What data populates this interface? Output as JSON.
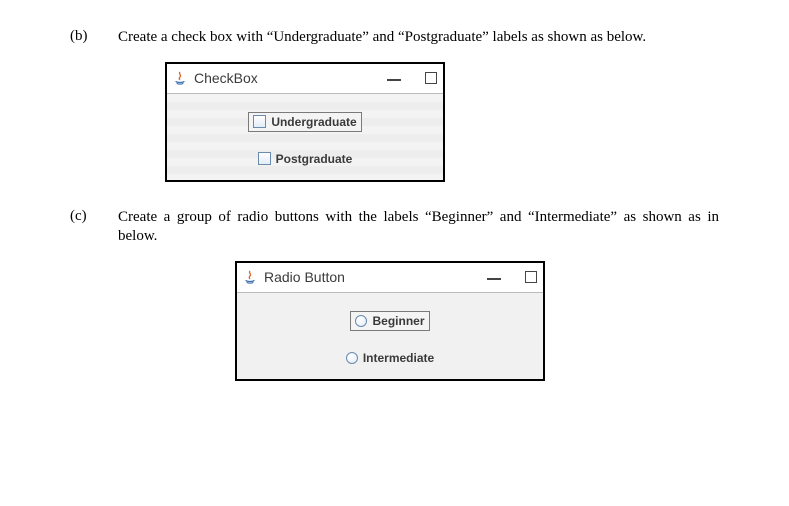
{
  "b": {
    "label": "(b)",
    "text": "Create a check box with “Undergraduate” and “Postgraduate” labels as shown as below.",
    "window_title": "CheckBox",
    "options": [
      "Undergraduate",
      "Postgraduate"
    ]
  },
  "c": {
    "label": "(c)",
    "text": "Create a group of radio buttons with the labels “Beginner” and “Intermediate” as shown as in below.",
    "window_title": "Radio Button",
    "options": [
      "Beginner",
      "Intermediate"
    ]
  },
  "icons": {
    "java": "java-icon",
    "minimize": "minimize-icon",
    "maximize": "maximize-icon"
  }
}
